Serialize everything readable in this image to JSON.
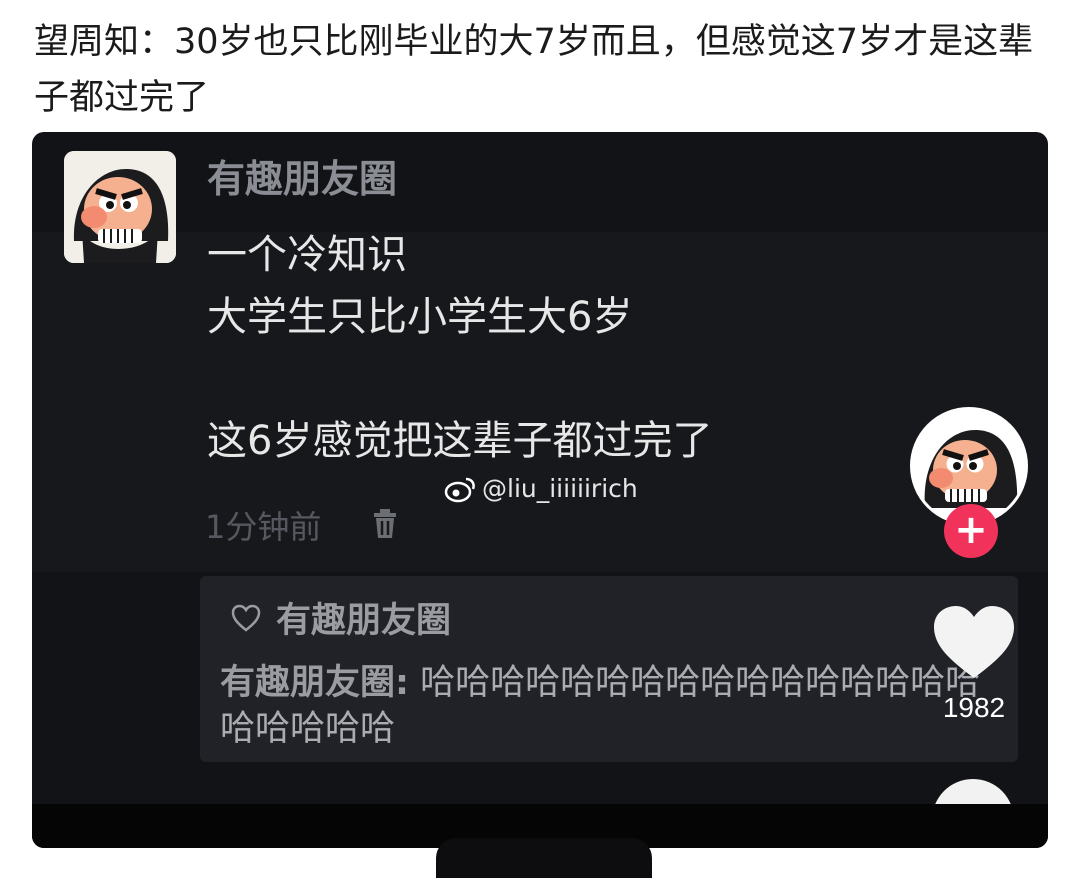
{
  "post": {
    "text": "望周知：30岁也只比刚毕业的大7岁而且，但感觉这7岁才是这辈子都过完了"
  },
  "screenshot": {
    "author": "有趣朋友圈",
    "content": "一个冷知识\n大学生只比小学生大6岁\n\n这6岁感觉把这辈子都过完了",
    "time": "1分钟前",
    "watermark": "@liu_iiiiiirich",
    "like_name": "有趣朋友圈",
    "comment_author": "有趣朋友圈:",
    "comment_text": " 哈哈哈哈哈哈哈哈哈哈哈哈哈哈哈哈哈哈哈哈哈"
  },
  "sidebar": {
    "follow_label": "+",
    "like_count": "1982"
  },
  "icons": {
    "trash": "trash-icon",
    "heart": "heart-icon",
    "heart_outline": "heart-outline-icon",
    "more": "more-icon",
    "weibo": "weibo-icon"
  },
  "colors": {
    "follow_button": "#f1325a",
    "media_background": "#121316"
  }
}
